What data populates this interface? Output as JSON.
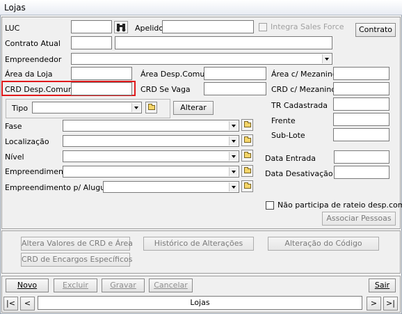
{
  "window": {
    "title": "Lojas"
  },
  "form": {
    "luc": {
      "label": "LUC",
      "value": ""
    },
    "apelido": {
      "label": "Apelido",
      "value": ""
    },
    "integra_sales_force": {
      "label": "Integra Sales Force",
      "checked": false
    },
    "contrato_button": "Contrato",
    "contrato_atual": {
      "label": "Contrato Atual",
      "value1": "",
      "value2": ""
    },
    "empreendedor": {
      "label": "Empreendedor",
      "value": ""
    },
    "area_da_loja": {
      "label": "Área da Loja",
      "value": ""
    },
    "area_desp_comum": {
      "label": "Área Desp.Comum",
      "value": ""
    },
    "area_c_mezanino": {
      "label": "Área c/ Mezanino",
      "value": ""
    },
    "crd_desp_comum": {
      "label": "CRD Desp.Comum",
      "value": ""
    },
    "crd_se_vaga": {
      "label": "CRD Se Vaga",
      "value": ""
    },
    "crd_c_mezanino": {
      "label": "CRD c/ Mezanino",
      "value": ""
    },
    "tipo": {
      "label": "Tipo",
      "value": ""
    },
    "alterar_button": "Alterar",
    "tr_cadastrada": {
      "label": "TR Cadastrada",
      "value": ""
    },
    "frente": {
      "label": "Frente",
      "value": ""
    },
    "sub_lote": {
      "label": "Sub-Lote",
      "value": ""
    },
    "fase": {
      "label": "Fase",
      "value": ""
    },
    "localizacao": {
      "label": "Localização",
      "value": ""
    },
    "nivel": {
      "label": "Nível",
      "value": ""
    },
    "empreendimento": {
      "label": "Empreendimento",
      "value": ""
    },
    "empreendimento_alugueis": {
      "label": "Empreendimento p/ Aluguéis",
      "value": ""
    },
    "data_entrada": {
      "label": "Data Entrada",
      "value": ""
    },
    "data_desativacao": {
      "label": "Data Desativação",
      "value": ""
    },
    "nao_participa": {
      "label": "Não participa de rateio desp.comum",
      "checked": false
    },
    "associar_pessoas_button": "Associar Pessoas"
  },
  "actions": {
    "altera_valores": "Altera Valores de CRD e Área",
    "historico": "Histórico de Alterações",
    "alteracao_codigo": "Alteração do Código",
    "crd_encargos": "CRD de Encargos Específicos"
  },
  "toolbar": {
    "novo": "Novo",
    "excluir": "Excluir",
    "gravar": "Gravar",
    "cancelar": "Cancelar",
    "sair": "Sair"
  },
  "navigator": {
    "first": "|<",
    "prev": "<",
    "label": "Lojas",
    "next": ">",
    "last": ">|"
  },
  "colors": {
    "highlight": "#e0191b",
    "folder": "#f6d66a"
  },
  "icons": [
    "binoculars-icon",
    "folder-icon",
    "chevron-down-icon"
  ]
}
